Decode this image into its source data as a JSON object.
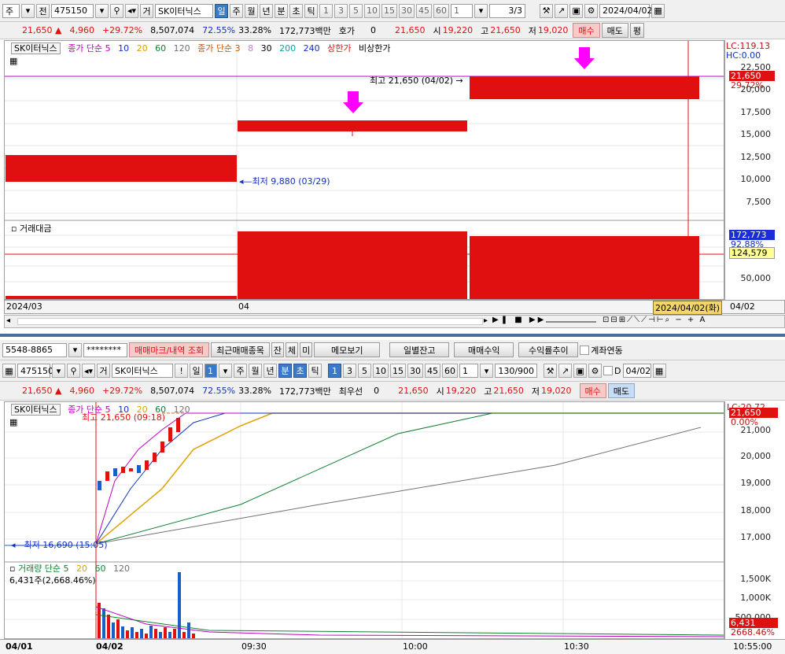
{
  "top": {
    "toolbar": {
      "market": "주",
      "prev": "전",
      "code": "475150",
      "trade_btn": "거",
      "stock_name": "SK이터닉스",
      "periods": [
        "일",
        "주",
        "월",
        "년",
        "분",
        "초",
        "틱"
      ],
      "active_period": "일",
      "nums": [
        "1",
        "3",
        "5",
        "10",
        "15",
        "30",
        "45",
        "60"
      ],
      "count": "1",
      "page": "3",
      "page_total": "/3",
      "date": "2024/04/02"
    },
    "quote": {
      "price": "21,650",
      "change": "4,960",
      "rate": "+29.72%",
      "volume": "8,507,074",
      "ratio": "72.55%",
      "turnover": "33.28%",
      "amount": "172,773백만",
      "label_hoga": "호가",
      "hoga": "0",
      "hoga_price": "21,650",
      "open_label": "시",
      "open": "19,220",
      "high_label": "고",
      "high": "21,650",
      "low_label": "저",
      "low": "19,020",
      "buy": "매수",
      "sell": "매도",
      "avg": "평"
    },
    "legend": {
      "name": "SK이터닉스",
      "ma1_label": "종가 단순 5",
      "ma1_vals": [
        "10",
        "20",
        "60",
        "120"
      ],
      "ma2_label": "종가 단순 3",
      "ma2_vals": [
        "8",
        "30",
        "200",
        "240"
      ],
      "upper": "상한가",
      "vi": "비상한가"
    },
    "right_top": {
      "lc": "LC:119.13",
      "hc": "HC:0.00"
    },
    "price_ticks": [
      "22,500",
      "20,000",
      "17,500",
      "15,000",
      "12,500",
      "10,000",
      "7,500"
    ],
    "price_badge": "21,650",
    "pct_badge": "29.72%",
    "max_note": "최고 21,650 (04/02)",
    "min_note": "최저 9,880 (03/29)",
    "vol_label": "거래대금",
    "vol_ticks": [
      "50,000"
    ],
    "vol_badge": "172,773",
    "vol_pct": "92.88%",
    "vol_badge2": "124,579",
    "x_labels": [
      "2024/03",
      "04"
    ],
    "x_cursor": "2024/04/02(화)",
    "x_right": "04/02"
  },
  "bottom": {
    "account": "5548-8865",
    "password": "********",
    "buttons": [
      "매매마크/내역 조회",
      "최근매매종목",
      "잔",
      "체",
      "미",
      "메모보기",
      "일별잔고",
      "매매수익",
      "수익률추이"
    ],
    "link_label": "계좌연동",
    "toolbar": {
      "code": "475150",
      "trade_btn": "거",
      "stock_name": "SK이터닉스",
      "bang": "!",
      "period": "일",
      "count1": "1",
      "periods": [
        "주",
        "월",
        "년",
        "분",
        "초",
        "틱"
      ],
      "active_periods": [
        "분",
        "초"
      ],
      "nums": [
        "1",
        "3",
        "5",
        "10",
        "15",
        "30",
        "45",
        "60"
      ],
      "count": "1",
      "range": "130/900",
      "d_label": "D",
      "date": "04/02"
    },
    "quote": {
      "price": "21,650",
      "change": "4,960",
      "rate": "+29.72%",
      "volume": "8,507,074",
      "ratio": "72.55%",
      "turnover": "33.28%",
      "amount": "172,773백만",
      "label_hoga": "최우선",
      "hoga": "0",
      "hoga_price": "21,650",
      "open_label": "시",
      "open": "19,220",
      "high_label": "고",
      "high": "21,650",
      "low_label": "저",
      "low": "19,020",
      "buy": "매수",
      "sell": "매도"
    },
    "legend": {
      "name": "SK이터닉스",
      "ma_label": "종가 단순 5",
      "ma_vals": [
        "10",
        "20",
        "60",
        "120"
      ]
    },
    "max_note": "최고 21,650 (09:18)",
    "min_note": "최저 16,690 (15:05)",
    "right_top": "LC:20.72",
    "price_ticks": [
      "21,000",
      "20,000",
      "19,000",
      "18,000",
      "17,000"
    ],
    "price_badge": "21,650",
    "pct_badge": "0.00%",
    "vol_label": "거래량 단순 5",
    "vol_vals": [
      "20",
      "60",
      "120"
    ],
    "vol_value": "6,431주(2,668.46%)",
    "vol_ticks": [
      "1,500K",
      "1,000K",
      "500,000"
    ],
    "vol_badge": "6,431",
    "vol_pct": "2668.46%",
    "x_labels": [
      "04/01",
      "04/02",
      "09:30",
      "10:00",
      "10:30",
      "10:55:00"
    ],
    "colors": {
      "up": "#e01010",
      "down": "#1a5fc8",
      "ma5": "#c000c0",
      "ma10": "#1030c0",
      "ma20": "#e0a000",
      "ma60": "#108030",
      "ma120": "#707070"
    }
  }
}
